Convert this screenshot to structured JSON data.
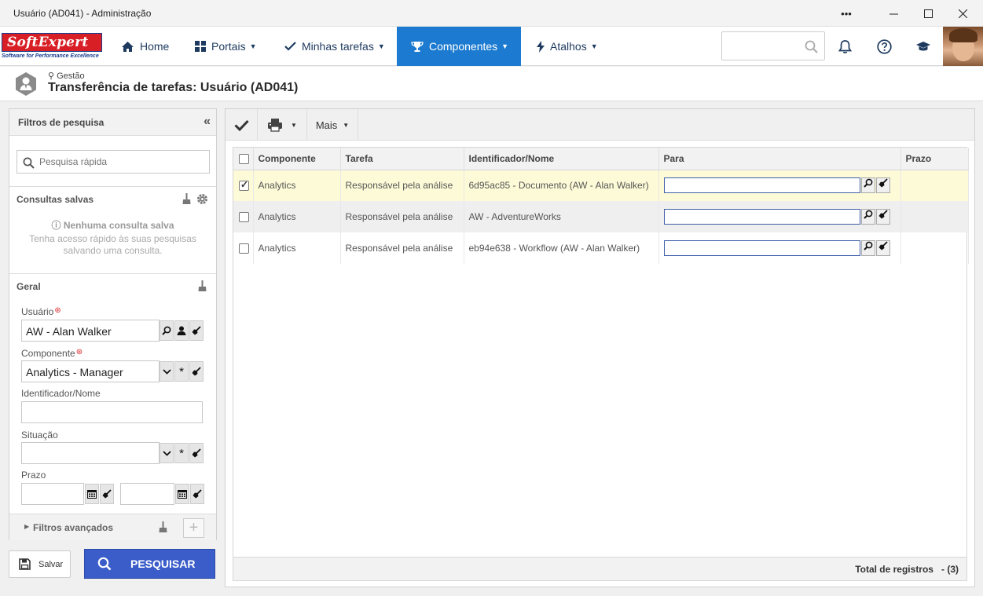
{
  "window": {
    "title": "Usuário (AD041) - Administração"
  },
  "brand": {
    "name": "SoftExpert",
    "tagline": "Software for Performance Excellence"
  },
  "nav": {
    "items": [
      {
        "label": "Home"
      },
      {
        "label": "Portais"
      },
      {
        "label": "Minhas tarefas"
      },
      {
        "label": "Componentes"
      },
      {
        "label": "Atalhos"
      }
    ],
    "search_placeholder": ""
  },
  "page": {
    "breadcrumb": "Gestão",
    "title": "Transferência de tarefas: Usuário (AD041)"
  },
  "filters": {
    "header": "Filtros de pesquisa",
    "quick_search_placeholder": "Pesquisa rápida",
    "saved": {
      "title": "Consultas salvas",
      "empty_title": "Nenhuma consulta salva",
      "empty_text": "Tenha acesso rápido às suas pesquisas salvando uma consulta."
    },
    "general": {
      "title": "Geral",
      "usuario_label": "Usuário",
      "usuario_value": "AW - Alan Walker",
      "componente_label": "Componente",
      "componente_value": "Analytics - Manager",
      "ident_label": "Identificador/Nome",
      "situacao_label": "Situação",
      "prazo_label": "Prazo"
    },
    "advanced": "Filtros avançados",
    "save_label": "Salvar",
    "search_label": "PESQUISAR"
  },
  "toolbar": {
    "more_label": "Mais"
  },
  "grid": {
    "columns": [
      "Componente",
      "Tarefa",
      "Identificador/Nome",
      "Para",
      "Prazo"
    ],
    "rows": [
      {
        "checked": true,
        "componente": "Analytics",
        "tarefa": "Responsável pela análise",
        "ident": "6d95ac85 - Documento (AW - Alan Walker)"
      },
      {
        "checked": false,
        "componente": "Analytics",
        "tarefa": "Responsável pela análise",
        "ident": "AW - AdventureWorks"
      },
      {
        "checked": false,
        "componente": "Analytics",
        "tarefa": "Responsável pela análise",
        "ident": "eb94e638 - Workflow (AW - Alan Walker)"
      }
    ],
    "total_label": "Total de registros",
    "total_value": "- (3)"
  },
  "colors": {
    "accent": "#1c7bd0",
    "search_button": "#3b5dc9",
    "selected_row": "#fdfbd7",
    "brand_red": "#d81f26"
  }
}
